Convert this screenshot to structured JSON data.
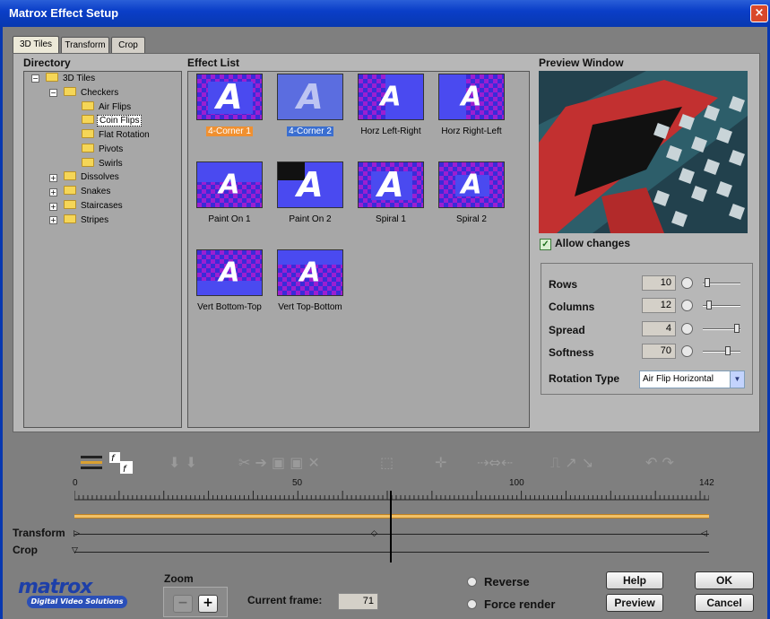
{
  "window": {
    "title": "Matrox Effect Setup",
    "close": "×"
  },
  "tabs": [
    "3D Tiles",
    "Transform",
    "Crop"
  ],
  "directory": {
    "title": "Directory",
    "items": [
      "3D Tiles",
      "Checkers",
      "Air Flips",
      "Coin Flips",
      "Flat Rotation",
      "Pivots",
      "Swirls",
      "Dissolves",
      "Snakes",
      "Staircases",
      "Stripes"
    ]
  },
  "effect_list": {
    "title": "Effect List",
    "items": [
      "4-Corner 1",
      "4-Corner 2",
      "Horz Left-Right",
      "Horz Right-Left",
      "Paint On 1",
      "Paint On 2",
      "Spiral 1",
      "Spiral 2",
      "Vert Bottom-Top",
      "Vert Top-Bottom"
    ],
    "thumb_letter": "A"
  },
  "preview": {
    "title": "Preview Window",
    "allow_changes": "Allow changes"
  },
  "params": {
    "rows": {
      "label": "Rows",
      "value": "10"
    },
    "columns": {
      "label": "Columns",
      "value": "12"
    },
    "spread": {
      "label": "Spread",
      "value": "4"
    },
    "softness": {
      "label": "Softness",
      "value": "70"
    },
    "rotation": {
      "label": "Rotation Type",
      "value": "Air Flip Horizontal"
    }
  },
  "timeline": {
    "ticks": [
      "0",
      "50",
      "100",
      "142"
    ],
    "transform_label": "Transform",
    "crop_label": "Crop"
  },
  "zoom": {
    "label": "Zoom",
    "minus": "−",
    "plus": "+"
  },
  "current_frame": {
    "label": "Current frame:",
    "value": "71"
  },
  "options": {
    "reverse": "Reverse",
    "force_render": "Force render"
  },
  "buttons": {
    "help": "Help",
    "ok": "OK",
    "preview": "Preview",
    "cancel": "Cancel"
  },
  "logo": {
    "name": "matrox",
    "tagline": "Digital Video Solutions"
  }
}
